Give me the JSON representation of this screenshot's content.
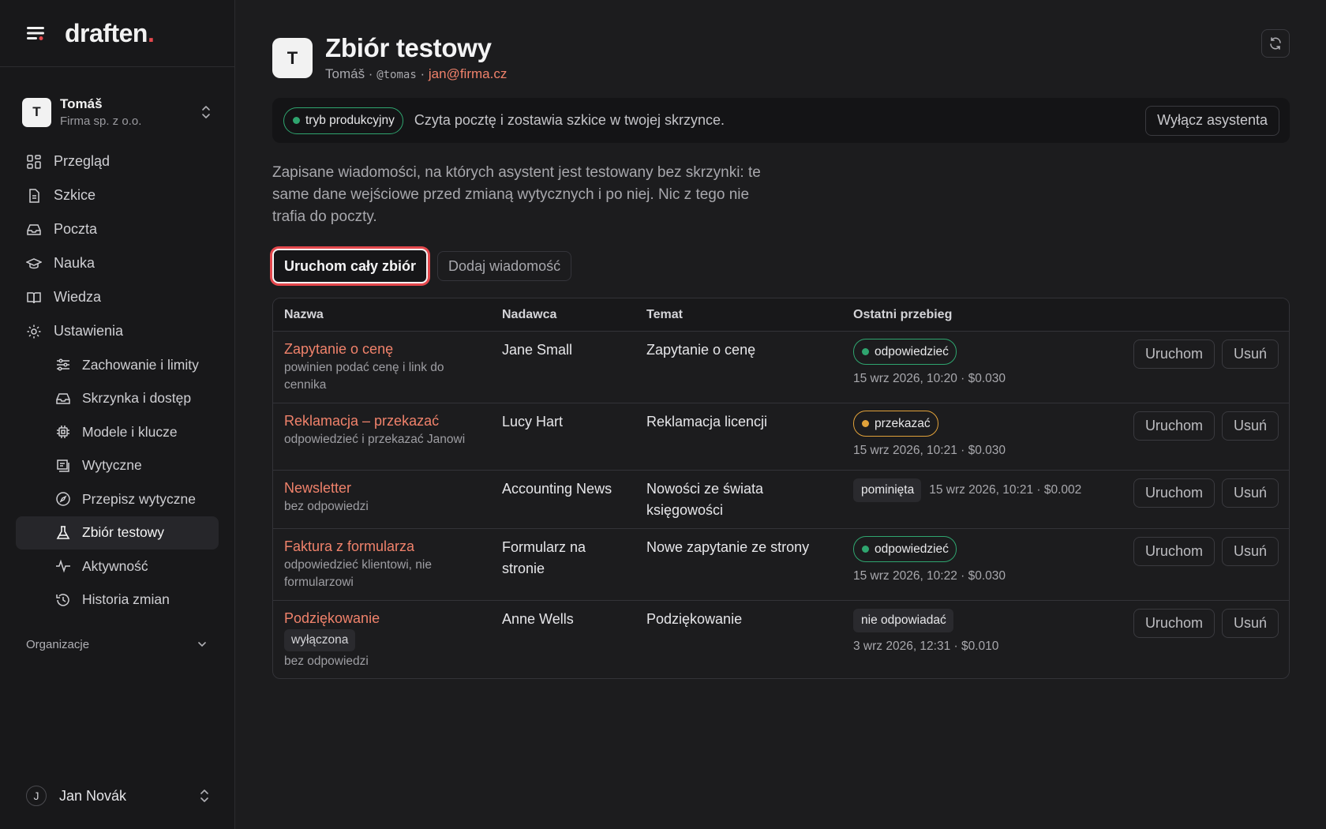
{
  "brand": {
    "name": "draften",
    "dot": "."
  },
  "org": {
    "initial": "T",
    "name": "Tomáš",
    "company": "Firma sp. z o.o."
  },
  "nav": {
    "items": [
      {
        "label": "Przegląd",
        "icon": "grid-icon"
      },
      {
        "label": "Szkice",
        "icon": "document-icon"
      },
      {
        "label": "Poczta",
        "icon": "inbox-icon"
      },
      {
        "label": "Nauka",
        "icon": "graduation-cap-icon"
      },
      {
        "label": "Wiedza",
        "icon": "book-icon"
      },
      {
        "label": "Ustawienia",
        "icon": "gear-icon"
      }
    ],
    "sub_items": [
      {
        "label": "Zachowanie i limity",
        "icon": "sliders-icon"
      },
      {
        "label": "Skrzynka i dostęp",
        "icon": "inbox-icon"
      },
      {
        "label": "Modele i klucze",
        "icon": "chip-icon"
      },
      {
        "label": "Wytyczne",
        "icon": "list-icon"
      },
      {
        "label": "Przepisz wytyczne",
        "icon": "compass-icon"
      },
      {
        "label": "Zbiór testowy",
        "icon": "flask-icon",
        "active": true
      },
      {
        "label": "Aktywność",
        "icon": "activity-icon"
      },
      {
        "label": "Historia zmian",
        "icon": "history-icon"
      }
    ],
    "section_label": "Organizacje"
  },
  "user": {
    "initial": "J",
    "name": "Jan Novák"
  },
  "header": {
    "initial": "T",
    "title": "Zbiór testowy",
    "name": "Tomáš",
    "sep1": " · ",
    "handle": "@tomas",
    "sep2": " · ",
    "email": "jan@firma.cz"
  },
  "banner": {
    "mode": "tryb produkcyjny",
    "text": "Czyta pocztę i zostawia szkice w twojej skrzynce.",
    "button": "Wyłącz asystenta"
  },
  "description": "Zapisane wiadomości, na których asystent jest testowany bez skrzynki: te same dane wejściowe przed zmianą wytycznych i po niej. Nic z tego nie trafia do poczty.",
  "actions": {
    "run_all": "Uruchom cały zbiór",
    "add": "Dodaj wiadomość"
  },
  "table": {
    "headers": [
      "Nazwa",
      "Nadawca",
      "Temat",
      "Ostatni przebieg"
    ],
    "run_label": "Uruchom",
    "delete_label": "Usuń",
    "rows": [
      {
        "name": "Zapytanie o cenę",
        "tag": "",
        "note": "powinien podać cenę i link do cennika",
        "sender": "Jane Small",
        "subject": "Zapytanie o cenę",
        "status": "odpowiedzieć",
        "status_kind": "green",
        "meta": "15 wrz 2026, 10:20 · $0.030"
      },
      {
        "name": "Reklamacja – przekazać",
        "tag": "",
        "note": "odpowiedzieć i przekazać Janowi",
        "sender": "Lucy Hart",
        "subject": "Reklamacja licencji",
        "status": "przekazać",
        "status_kind": "orange",
        "meta": "15 wrz 2026, 10:21 · $0.030"
      },
      {
        "name": "Newsletter",
        "tag": "",
        "note": "bez odpowiedzi",
        "sender": "Accounting News",
        "subject": "Nowości ze świata księgowości",
        "status": "pominięta",
        "status_kind": "grey-inline",
        "meta": "15 wrz 2026, 10:21 · $0.002"
      },
      {
        "name": "Faktura z formularza",
        "tag": "",
        "note": "odpowiedzieć klientowi, nie formularzowi",
        "sender": "Formularz na stronie",
        "subject": "Nowe zapytanie ze strony",
        "status": "odpowiedzieć",
        "status_kind": "green",
        "meta": "15 wrz 2026, 10:22 · $0.030"
      },
      {
        "name": "Podziękowanie",
        "tag": "wyłączona",
        "note": "bez odpowiedzi",
        "sender": "Anne Wells",
        "subject": "Podziękowanie",
        "status": "nie odpowiadać",
        "status_kind": "grey",
        "meta": "3 wrz 2026, 12:31 · $0.010"
      }
    ]
  },
  "colors": {
    "accent": "#f0826b",
    "green": "#2fa56f",
    "orange": "#e0a13a",
    "red": "#e5484d"
  }
}
